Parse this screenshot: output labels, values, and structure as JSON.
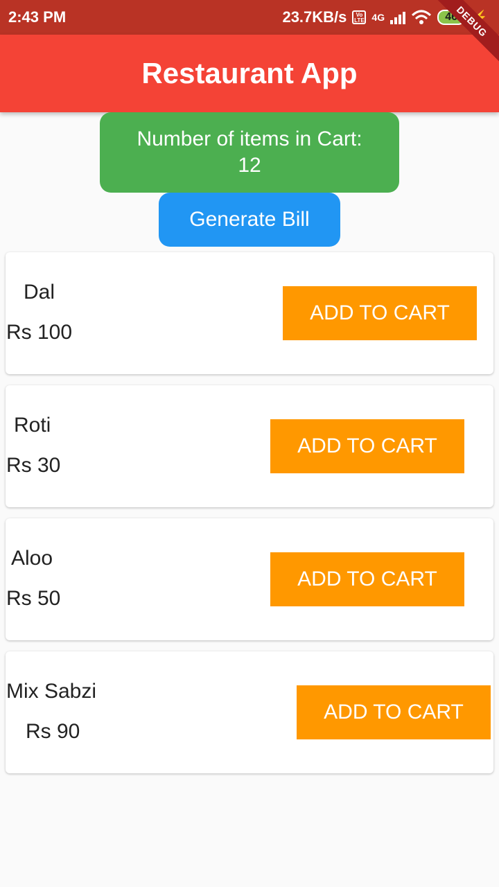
{
  "status_bar": {
    "time": "2:43 PM",
    "net_speed": "23.7KB/s",
    "volte_badge": "Vo LTE",
    "network_type": "4G",
    "battery": "46"
  },
  "debug_banner": "DEBUG",
  "app_bar": {
    "title": "Restaurant App"
  },
  "cart": {
    "label": "Number of items in Cart:",
    "count": "12",
    "generate_bill_label": "Generate Bill"
  },
  "menu": {
    "items": [
      {
        "name": "Dal",
        "price": "Rs 100",
        "button": "ADD TO CART"
      },
      {
        "name": "Roti",
        "price": "Rs 30",
        "button": "ADD TO CART"
      },
      {
        "name": "Aloo",
        "price": "Rs 50",
        "button": "ADD TO CART"
      },
      {
        "name": "Mix Sabzi",
        "price": "Rs 90",
        "button": "ADD TO CART"
      }
    ]
  },
  "colors": {
    "status_bar": "#b93325",
    "app_bar": "#f44336",
    "cart_box": "#4caf50",
    "bill_button": "#2196f3",
    "add_button": "#ff9800"
  }
}
